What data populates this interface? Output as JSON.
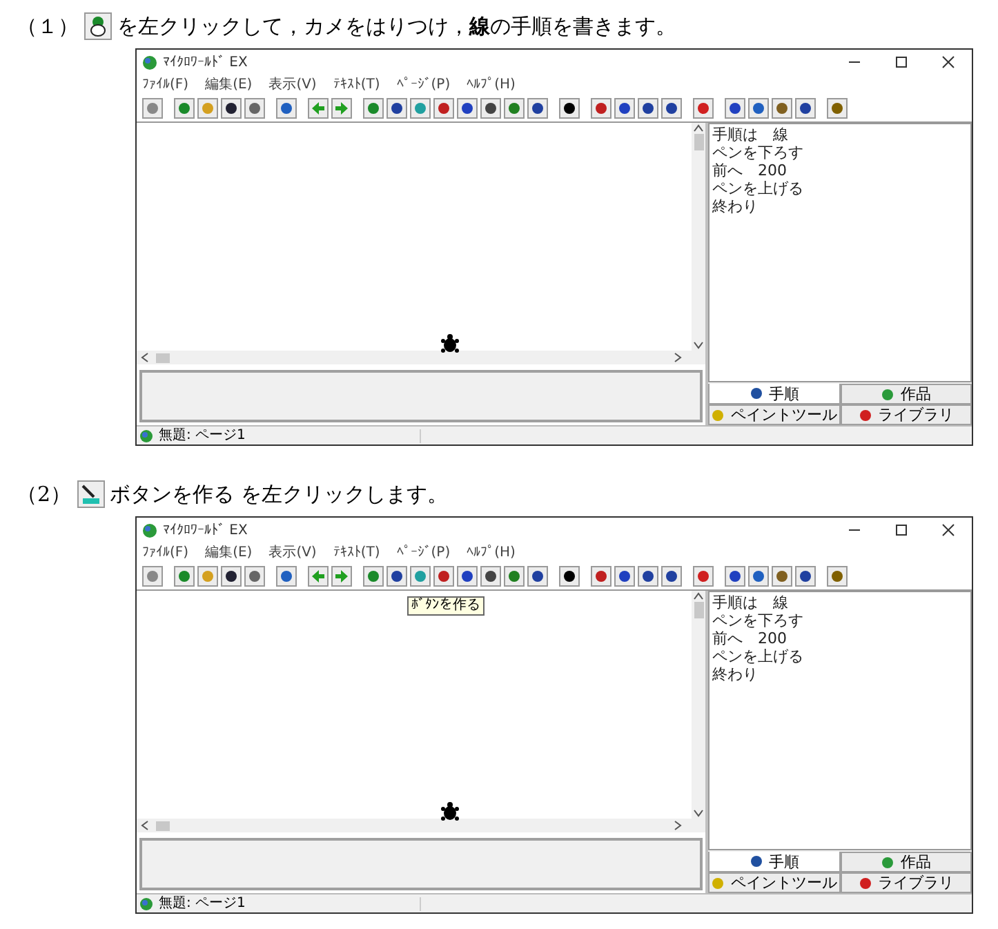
{
  "sections": [
    {
      "number": "（１）",
      "instruction": "を左クリックして，カメをはりつけ，**線**の手順を書きます。",
      "window": {
        "title": "ﾏｲｸﾛﾜｰﾙﾄﾞ EX",
        "menu": [
          "ﾌｧｲﾙ(F)",
          "編集(E)",
          "表示(V)",
          "ﾃｷｽﾄ(T)",
          "ﾍﾟｰｼﾞ(P)",
          "ﾍﾙﾌﾟ(H)"
        ],
        "procedure_lines": [
          "手順は　線",
          "ペンを下ろす",
          "前へ　200",
          "ペンを上げる",
          "終わり"
        ],
        "tabs": [
          {
            "label": "手順",
            "selected": true
          },
          {
            "label": "作品",
            "selected": false
          },
          {
            "label": "ペイントツール",
            "selected": false
          },
          {
            "label": "ライブラリ",
            "selected": false
          }
        ],
        "status": "無題: ページ1"
      }
    },
    {
      "number": "（2）",
      "instruction": "ボタンを作る を左クリックします。",
      "window": {
        "title": "ﾏｲｸﾛﾜｰﾙﾄﾞ EX",
        "menu": [
          "ﾌｧｲﾙ(F)",
          "編集(E)",
          "表示(V)",
          "ﾃｷｽﾄ(T)",
          "ﾍﾟｰｼﾞ(P)",
          "ﾍﾙﾌﾟ(H)"
        ],
        "tooltip": "ﾎﾞﾀﾝを作る",
        "procedure_lines": [
          "手順は　線",
          "ペンを下ろす",
          "前へ　200",
          "ペンを上げる",
          "終わり"
        ],
        "tabs": [
          {
            "label": "手順",
            "selected": true
          },
          {
            "label": "作品",
            "selected": false
          },
          {
            "label": "ペイントツール",
            "selected": false
          },
          {
            "label": "ライブラリ",
            "selected": false
          }
        ],
        "status": "無題: ページ1"
      }
    }
  ]
}
